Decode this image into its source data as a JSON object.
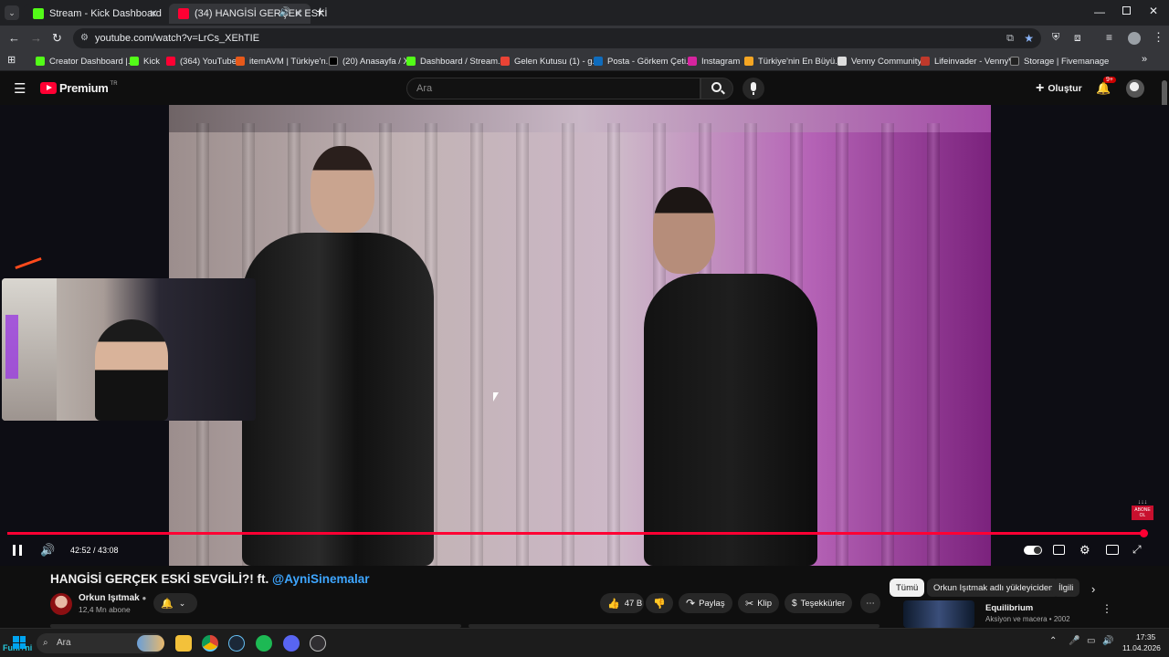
{
  "browser": {
    "tabs": [
      {
        "label": "Stream - Kick Dashboard",
        "active": false,
        "icon": "kick-icon"
      },
      {
        "label": "(34) HANGİSİ GERÇEK ESKİ",
        "active": true,
        "icon": "youtube-icon"
      }
    ],
    "url": "youtube.com/watch?v=LrCs_XEhTIE",
    "bookmarks": [
      "Creator Dashboard |...",
      "Kick",
      "(364) YouTube",
      "itemAVM | Türkiye'n...",
      "(20) Anasayfa / X",
      "Dashboard / Stream...",
      "Gelen Kutusu (1) - g...",
      "Posta - Görkem Çeti...",
      "Instagram",
      "Türkiye'nin En Büyü...",
      "Venny Community",
      "Lifeinvader - VennyV",
      "Storage | Fivemanage"
    ]
  },
  "youtube": {
    "logo_text": "Premium",
    "logo_region": "TR",
    "search_placeholder": "Ara",
    "create_label": "Oluştur",
    "notifications_badge": "9+",
    "player": {
      "time": "42:52 / 43:08",
      "progress": 0.994,
      "subscribe_watermark": "ABONE OL"
    },
    "video": {
      "title_main": "HANGİSİ GERÇEK ESKİ SEVGİLİ?! ft.",
      "title_mention": "@AyniSinemalar",
      "channel_name": "Orkun Işıtmak",
      "subscribers": "12,4 Mn abone",
      "likes": "47 B",
      "share_label": "Paylaş",
      "clip_label": "Klip",
      "thanks_label": "Teşekkürler"
    },
    "chips": [
      "Tümü",
      "Orkun Işıtmak adlı yükleyiciden",
      "İlgili"
    ],
    "recommendation": {
      "title": "Equilibrium",
      "meta": "Aksiyon ve macera • 2002"
    }
  },
  "taskbar": {
    "left_label": "Funi+ni",
    "search_placeholder": "Ara",
    "time": "17:35",
    "date": "11.04.2026"
  },
  "colors": {
    "yt_red": "#ff0033",
    "bg": "#0f0f0f",
    "link": "#3ea6ff"
  }
}
